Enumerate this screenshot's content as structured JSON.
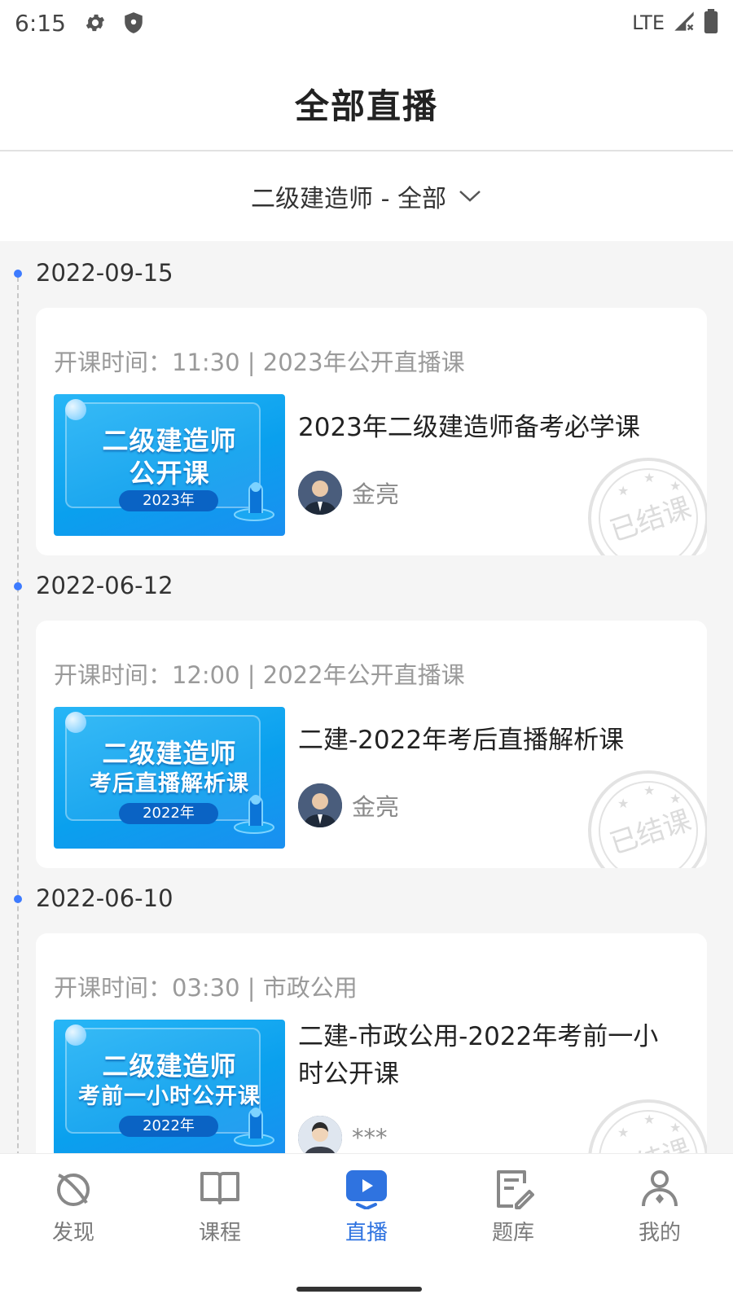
{
  "status_bar": {
    "time": "6:15",
    "network": "LTE"
  },
  "header": {
    "title": "全部直播"
  },
  "filter": {
    "label": "二级建造师 - 全部"
  },
  "groups": [
    {
      "date": "2022-09-15",
      "meta": "开课时间：11:30 | 2023年公开直播课",
      "title": "2023年二级建造师备考必学课",
      "teacher": "金亮",
      "thumb_line1": "二级建造师",
      "thumb_line2": "公开课",
      "thumb_year": "2023年",
      "stamp": "已结课"
    },
    {
      "date": "2022-06-12",
      "meta": "开课时间：12:00 | 2022年公开直播课",
      "title": "二建-2022年考后直播解析课",
      "teacher": "金亮",
      "thumb_line1": "二级建造师",
      "thumb_line2": "考后直播解析课",
      "thumb_year": "2022年",
      "stamp": "已结课"
    },
    {
      "date": "2022-06-10",
      "meta": "开课时间：03:30 | 市政公用",
      "title": "二建-市政公用-2022年考前一小时公开课",
      "teacher": "***",
      "thumb_line1": "二级建造师",
      "thumb_line2": "考前一小时公开课",
      "thumb_year": "2022年",
      "stamp": "已结课"
    }
  ],
  "nav": [
    {
      "label": "发现",
      "icon": "discover-icon"
    },
    {
      "label": "课程",
      "icon": "book-icon"
    },
    {
      "label": "直播",
      "icon": "live-icon",
      "active": true
    },
    {
      "label": "题库",
      "icon": "exam-icon"
    },
    {
      "label": "我的",
      "icon": "profile-icon"
    }
  ],
  "colors": {
    "accent": "#2f73e0",
    "timeline_dot": "#3d7bff",
    "background": "#f5f5f5"
  }
}
